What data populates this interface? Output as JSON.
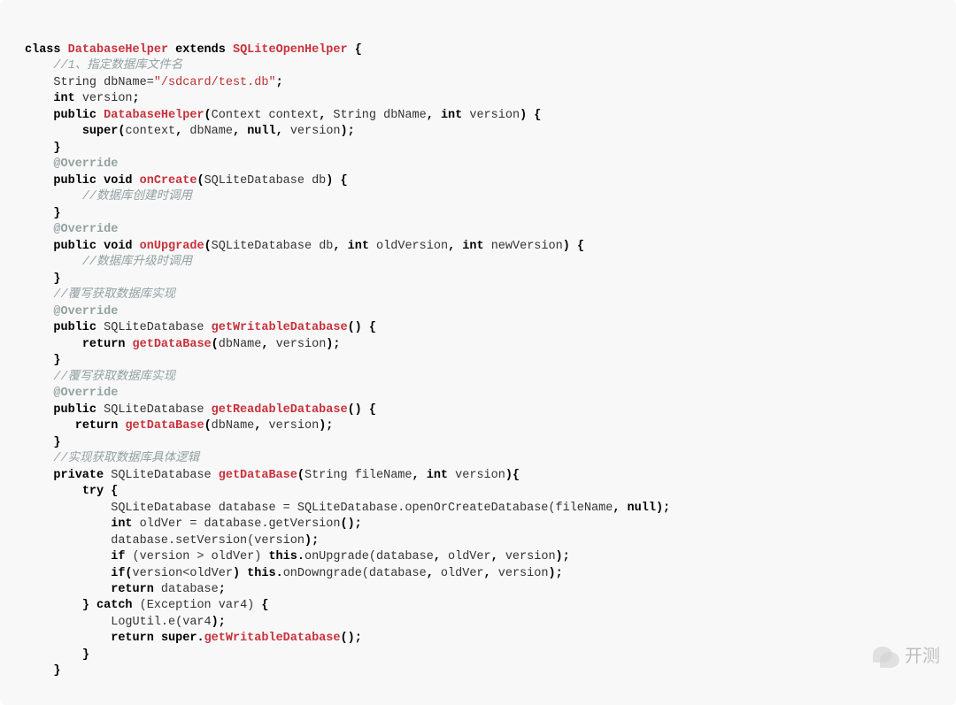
{
  "code": {
    "lines": [
      {
        "indent": 0,
        "tokens": [
          {
            "t": "kw",
            "v": "class"
          },
          {
            "t": "sp",
            "v": " "
          },
          {
            "t": "cls",
            "v": "DatabaseHelper"
          },
          {
            "t": "sp",
            "v": " "
          },
          {
            "t": "kw",
            "v": "extends"
          },
          {
            "t": "sp",
            "v": " "
          },
          {
            "t": "cls",
            "v": "SQLiteOpenHelper"
          },
          {
            "t": "sp",
            "v": " "
          },
          {
            "t": "pun",
            "v": "{"
          }
        ]
      },
      {
        "indent": 1,
        "tokens": [
          {
            "t": "cmt",
            "v": "//1、指定数据库文件名"
          }
        ]
      },
      {
        "indent": 1,
        "tokens": [
          {
            "t": "txt",
            "v": "String dbName="
          },
          {
            "t": "str",
            "v": "\"/sdcard/test.db\""
          },
          {
            "t": "pun",
            "v": ";"
          }
        ]
      },
      {
        "indent": 1,
        "tokens": [
          {
            "t": "kw",
            "v": "int"
          },
          {
            "t": "txt",
            "v": " version"
          },
          {
            "t": "pun",
            "v": ";"
          }
        ]
      },
      {
        "indent": 1,
        "tokens": [
          {
            "t": "kw",
            "v": "public"
          },
          {
            "t": "sp",
            "v": " "
          },
          {
            "t": "cls",
            "v": "DatabaseHelper"
          },
          {
            "t": "pun",
            "v": "("
          },
          {
            "t": "txt",
            "v": "Context context"
          },
          {
            "t": "pun",
            "v": ","
          },
          {
            "t": "txt",
            "v": " String dbName"
          },
          {
            "t": "pun",
            "v": ","
          },
          {
            "t": "sp",
            "v": " "
          },
          {
            "t": "kw",
            "v": "int"
          },
          {
            "t": "txt",
            "v": " version"
          },
          {
            "t": "pun",
            "v": ")"
          },
          {
            "t": "sp",
            "v": " "
          },
          {
            "t": "pun",
            "v": "{"
          }
        ]
      },
      {
        "indent": 2,
        "tokens": [
          {
            "t": "kw",
            "v": "super"
          },
          {
            "t": "pun",
            "v": "("
          },
          {
            "t": "txt",
            "v": "context"
          },
          {
            "t": "pun",
            "v": ","
          },
          {
            "t": "txt",
            "v": " dbName"
          },
          {
            "t": "pun",
            "v": ","
          },
          {
            "t": "sp",
            "v": " "
          },
          {
            "t": "kw",
            "v": "null"
          },
          {
            "t": "pun",
            "v": ","
          },
          {
            "t": "txt",
            "v": " version"
          },
          {
            "t": "pun",
            "v": ");"
          }
        ]
      },
      {
        "indent": 1,
        "tokens": [
          {
            "t": "pun",
            "v": "}"
          }
        ]
      },
      {
        "indent": 1,
        "tokens": [
          {
            "t": "ann",
            "v": "@Override"
          }
        ]
      },
      {
        "indent": 1,
        "tokens": [
          {
            "t": "kw",
            "v": "public"
          },
          {
            "t": "sp",
            "v": " "
          },
          {
            "t": "kw",
            "v": "void"
          },
          {
            "t": "sp",
            "v": " "
          },
          {
            "t": "mth",
            "v": "onCreate"
          },
          {
            "t": "pun",
            "v": "("
          },
          {
            "t": "txt",
            "v": "SQLiteDatabase db"
          },
          {
            "t": "pun",
            "v": ")"
          },
          {
            "t": "sp",
            "v": " "
          },
          {
            "t": "pun",
            "v": "{"
          }
        ]
      },
      {
        "indent": 2,
        "tokens": [
          {
            "t": "cmt",
            "v": "//数据库创建时调用"
          }
        ]
      },
      {
        "indent": 1,
        "tokens": [
          {
            "t": "pun",
            "v": "}"
          }
        ]
      },
      {
        "indent": 1,
        "tokens": [
          {
            "t": "ann",
            "v": "@Override"
          }
        ]
      },
      {
        "indent": 1,
        "tokens": [
          {
            "t": "kw",
            "v": "public"
          },
          {
            "t": "sp",
            "v": " "
          },
          {
            "t": "kw",
            "v": "void"
          },
          {
            "t": "sp",
            "v": " "
          },
          {
            "t": "mth",
            "v": "onUpgrade"
          },
          {
            "t": "pun",
            "v": "("
          },
          {
            "t": "txt",
            "v": "SQLiteDatabase db"
          },
          {
            "t": "pun",
            "v": ","
          },
          {
            "t": "sp",
            "v": " "
          },
          {
            "t": "kw",
            "v": "int"
          },
          {
            "t": "txt",
            "v": " oldVersion"
          },
          {
            "t": "pun",
            "v": ","
          },
          {
            "t": "sp",
            "v": " "
          },
          {
            "t": "kw",
            "v": "int"
          },
          {
            "t": "txt",
            "v": " newVersion"
          },
          {
            "t": "pun",
            "v": ")"
          },
          {
            "t": "sp",
            "v": " "
          },
          {
            "t": "pun",
            "v": "{"
          }
        ]
      },
      {
        "indent": 2,
        "tokens": [
          {
            "t": "cmt",
            "v": "//数据库升级时调用"
          }
        ]
      },
      {
        "indent": 1,
        "tokens": [
          {
            "t": "pun",
            "v": "}"
          }
        ]
      },
      {
        "indent": 1,
        "tokens": [
          {
            "t": "cmt",
            "v": "//覆写获取数据库实现"
          }
        ]
      },
      {
        "indent": 1,
        "tokens": [
          {
            "t": "ann",
            "v": "@Override"
          }
        ]
      },
      {
        "indent": 1,
        "tokens": [
          {
            "t": "kw",
            "v": "public"
          },
          {
            "t": "txt",
            "v": " SQLiteDatabase "
          },
          {
            "t": "mth",
            "v": "getWritableDatabase"
          },
          {
            "t": "pun",
            "v": "()"
          },
          {
            "t": "sp",
            "v": " "
          },
          {
            "t": "pun",
            "v": "{"
          }
        ]
      },
      {
        "indent": 2,
        "tokens": [
          {
            "t": "kw",
            "v": "return"
          },
          {
            "t": "sp",
            "v": " "
          },
          {
            "t": "mth",
            "v": "getDataBase"
          },
          {
            "t": "pun",
            "v": "("
          },
          {
            "t": "txt",
            "v": "dbName"
          },
          {
            "t": "pun",
            "v": ","
          },
          {
            "t": "txt",
            "v": " version"
          },
          {
            "t": "pun",
            "v": ");"
          }
        ]
      },
      {
        "indent": 1,
        "tokens": [
          {
            "t": "pun",
            "v": "}"
          }
        ]
      },
      {
        "indent": 1,
        "tokens": [
          {
            "t": "cmt",
            "v": "//覆写获取数据库实现"
          }
        ]
      },
      {
        "indent": 1,
        "tokens": [
          {
            "t": "ann",
            "v": "@Override"
          }
        ]
      },
      {
        "indent": 1,
        "tokens": [
          {
            "t": "kw",
            "v": "public"
          },
          {
            "t": "txt",
            "v": " SQLiteDatabase "
          },
          {
            "t": "mth",
            "v": "getReadableDatabase"
          },
          {
            "t": "pun",
            "v": "()"
          },
          {
            "t": "sp",
            "v": " "
          },
          {
            "t": "pun",
            "v": "{"
          }
        ]
      },
      {
        "indent": 1,
        "tokens": [
          {
            "t": "txt",
            "v": "   "
          },
          {
            "t": "kw",
            "v": "return"
          },
          {
            "t": "sp",
            "v": " "
          },
          {
            "t": "mth",
            "v": "getDataBase"
          },
          {
            "t": "pun",
            "v": "("
          },
          {
            "t": "txt",
            "v": "dbName"
          },
          {
            "t": "pun",
            "v": ","
          },
          {
            "t": "txt",
            "v": " version"
          },
          {
            "t": "pun",
            "v": ");"
          }
        ]
      },
      {
        "indent": 1,
        "tokens": [
          {
            "t": "pun",
            "v": "}"
          }
        ]
      },
      {
        "indent": 1,
        "tokens": [
          {
            "t": "cmt",
            "v": "//实现获取数据库具体逻辑"
          }
        ]
      },
      {
        "indent": 1,
        "tokens": [
          {
            "t": "kw",
            "v": "private"
          },
          {
            "t": "txt",
            "v": " SQLiteDatabase "
          },
          {
            "t": "mth",
            "v": "getDataBase"
          },
          {
            "t": "pun",
            "v": "("
          },
          {
            "t": "txt",
            "v": "String fileName"
          },
          {
            "t": "pun",
            "v": ","
          },
          {
            "t": "sp",
            "v": " "
          },
          {
            "t": "kw",
            "v": "int"
          },
          {
            "t": "txt",
            "v": " version"
          },
          {
            "t": "pun",
            "v": "){"
          }
        ]
      },
      {
        "indent": 2,
        "tokens": [
          {
            "t": "kw",
            "v": "try"
          },
          {
            "t": "sp",
            "v": " "
          },
          {
            "t": "pun",
            "v": "{"
          }
        ]
      },
      {
        "indent": 3,
        "tokens": [
          {
            "t": "txt",
            "v": "SQLiteDatabase database = SQLiteDatabase.openOrCreateDatabase(fileName"
          },
          {
            "t": "pun",
            "v": ","
          },
          {
            "t": "sp",
            "v": " "
          },
          {
            "t": "kw",
            "v": "null"
          },
          {
            "t": "pun",
            "v": ");"
          }
        ]
      },
      {
        "indent": 3,
        "tokens": [
          {
            "t": "kw",
            "v": "int"
          },
          {
            "t": "txt",
            "v": " oldVer = database.getVersion"
          },
          {
            "t": "pun",
            "v": "();"
          }
        ]
      },
      {
        "indent": 3,
        "tokens": [
          {
            "t": "txt",
            "v": "database.setVersion(version"
          },
          {
            "t": "pun",
            "v": ");"
          }
        ]
      },
      {
        "indent": 3,
        "tokens": [
          {
            "t": "kw",
            "v": "if"
          },
          {
            "t": "txt",
            "v": " (version > oldVer) "
          },
          {
            "t": "kw",
            "v": "this"
          },
          {
            "t": "pun",
            "v": "."
          },
          {
            "t": "txt",
            "v": "onUpgrade(database"
          },
          {
            "t": "pun",
            "v": ","
          },
          {
            "t": "txt",
            "v": " oldVer"
          },
          {
            "t": "pun",
            "v": ","
          },
          {
            "t": "txt",
            "v": " version"
          },
          {
            "t": "pun",
            "v": ");"
          }
        ]
      },
      {
        "indent": 3,
        "tokens": [
          {
            "t": "kw",
            "v": "if"
          },
          {
            "t": "pun",
            "v": "("
          },
          {
            "t": "txt",
            "v": "version<oldVer"
          },
          {
            "t": "pun",
            "v": ")"
          },
          {
            "t": "sp",
            "v": " "
          },
          {
            "t": "kw",
            "v": "this"
          },
          {
            "t": "pun",
            "v": "."
          },
          {
            "t": "txt",
            "v": "onDowngrade(database"
          },
          {
            "t": "pun",
            "v": ","
          },
          {
            "t": "txt",
            "v": " oldVer"
          },
          {
            "t": "pun",
            "v": ","
          },
          {
            "t": "txt",
            "v": " version"
          },
          {
            "t": "pun",
            "v": ");"
          }
        ]
      },
      {
        "indent": 3,
        "tokens": [
          {
            "t": "kw",
            "v": "return"
          },
          {
            "t": "txt",
            "v": " database"
          },
          {
            "t": "pun",
            "v": ";"
          }
        ]
      },
      {
        "indent": 2,
        "tokens": [
          {
            "t": "pun",
            "v": "}"
          },
          {
            "t": "sp",
            "v": " "
          },
          {
            "t": "kw",
            "v": "catch"
          },
          {
            "t": "txt",
            "v": " (Exception var4) "
          },
          {
            "t": "pun",
            "v": "{"
          }
        ]
      },
      {
        "indent": 3,
        "tokens": [
          {
            "t": "txt",
            "v": "LogUtil.e(var4"
          },
          {
            "t": "pun",
            "v": ");"
          }
        ]
      },
      {
        "indent": 3,
        "tokens": [
          {
            "t": "kw",
            "v": "return"
          },
          {
            "t": "sp",
            "v": " "
          },
          {
            "t": "kw",
            "v": "super"
          },
          {
            "t": "pun",
            "v": "."
          },
          {
            "t": "mth",
            "v": "getWritableDatabase"
          },
          {
            "t": "pun",
            "v": "();"
          }
        ]
      },
      {
        "indent": 2,
        "tokens": [
          {
            "t": "pun",
            "v": "}"
          }
        ]
      },
      {
        "indent": 1,
        "tokens": [
          {
            "t": "pun",
            "v": "}"
          }
        ]
      }
    ]
  },
  "watermark": {
    "text": "开测"
  }
}
